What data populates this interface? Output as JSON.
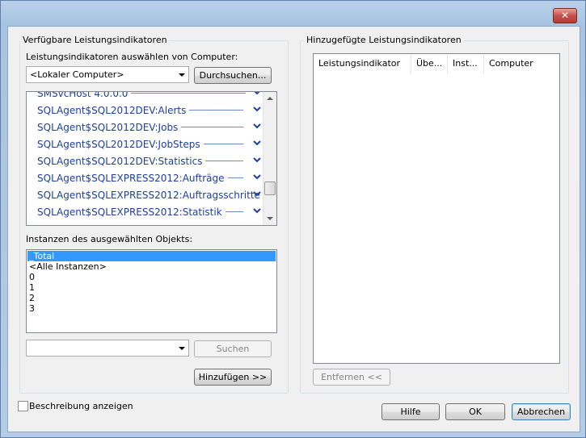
{
  "window": {
    "close_glyph": "✕"
  },
  "available": {
    "group_label": "Verfügbare Leistungsindikatoren",
    "computer_label": "Leistungsindikatoren auswählen von Computer:",
    "computer_value": "<Lokaler Computer>",
    "browse_label": "Durchsuchen...",
    "counters": [
      "SMSvcHost 4.0.0.0",
      "SQLAgent$SQL2012DEV:Alerts",
      "SQLAgent$SQL2012DEV:Jobs",
      "SQLAgent$SQL2012DEV:JobSteps",
      "SQLAgent$SQL2012DEV:Statistics",
      "SQLAgent$SQLEXPRESS2012:Aufträge",
      "SQLAgent$SQLEXPRESS2012:Auftragsschritte",
      "SQLAgent$SQLEXPRESS2012:Statistik"
    ],
    "instances_label": "Instanzen des ausgewählten Objekts:",
    "instances": [
      "_Total",
      "<Alle Instanzen>",
      "0",
      "1",
      "2",
      "3"
    ],
    "search_value": "",
    "search_label": "Suchen",
    "add_label": "Hinzufügen >>"
  },
  "added": {
    "group_label": "Hinzugefügte Leistungsindikatoren",
    "columns": [
      "Leistungsindikator",
      "Übe...",
      "Inst...",
      "Computer"
    ],
    "remove_label": "Entfernen <<"
  },
  "footer": {
    "show_description_label": "Beschreibung anzeigen",
    "show_description_checked": false,
    "help_label": "Hilfe",
    "ok_label": "OK",
    "cancel_label": "Abbrechen"
  },
  "colors": {
    "link_blue": "#1b3fa0",
    "selection": "#3399ff"
  }
}
